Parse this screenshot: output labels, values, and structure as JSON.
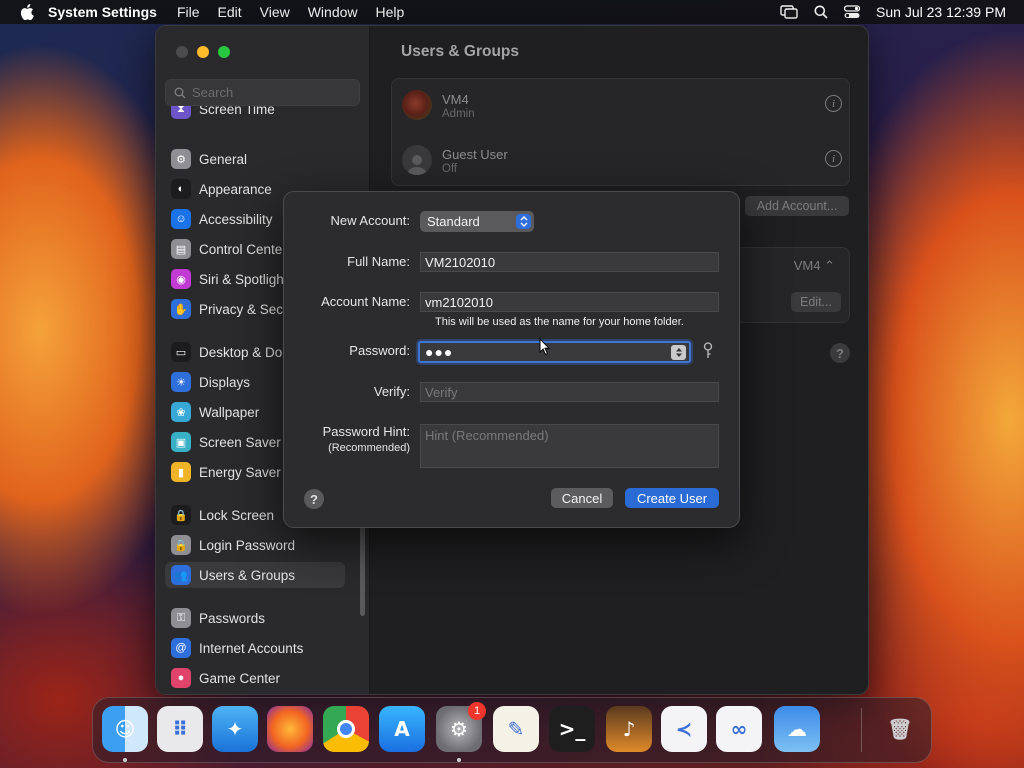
{
  "menubar": {
    "app_name": "System Settings",
    "menus": [
      "File",
      "Edit",
      "View",
      "Window",
      "Help"
    ],
    "clock": "Sun Jul 23  12:39 PM"
  },
  "sidebar": {
    "search_placeholder": "Search",
    "items": [
      {
        "label": "Screen Time",
        "icon": "hourglass-icon",
        "color": "#6b55c8"
      },
      {
        "label": "General",
        "icon": "gear-icon",
        "color": "#8e8e93"
      },
      {
        "label": "Appearance",
        "icon": "appearance-icon",
        "color": "#1c1c1e"
      },
      {
        "label": "Accessibility",
        "icon": "accessibility-icon",
        "color": "#1a73e8"
      },
      {
        "label": "Control Center",
        "icon": "control-center-icon",
        "color": "#8e8e93"
      },
      {
        "label": "Siri & Spotlight",
        "icon": "siri-icon",
        "color": "#c23bd4"
      },
      {
        "label": "Privacy & Security",
        "icon": "hand-icon",
        "color": "#2f6fdb"
      },
      {
        "label": "Desktop & Dock",
        "icon": "dock-icon",
        "color": "#1c1c1e"
      },
      {
        "label": "Displays",
        "icon": "sun-icon",
        "color": "#2f6fdb"
      },
      {
        "label": "Wallpaper",
        "icon": "wallpaper-icon",
        "color": "#38a9d6"
      },
      {
        "label": "Screen Saver",
        "icon": "screen-saver-icon",
        "color": "#38b0c6"
      },
      {
        "label": "Energy Saver",
        "icon": "battery-icon",
        "color": "#f0b429"
      },
      {
        "label": "Lock Screen",
        "icon": "lock-icon",
        "color": "#1c1c1e"
      },
      {
        "label": "Login Password",
        "icon": "lock-icon",
        "color": "#8e8e93"
      },
      {
        "label": "Users & Groups",
        "icon": "users-icon",
        "color": "#2f6fdb"
      },
      {
        "label": "Passwords",
        "icon": "key-icon",
        "color": "#8e8e93"
      },
      {
        "label": "Internet Accounts",
        "icon": "at-icon",
        "color": "#2f6fdb"
      },
      {
        "label": "Game Center",
        "icon": "game-center-icon",
        "color": "#e0446a"
      }
    ]
  },
  "content": {
    "title": "Users & Groups",
    "users": [
      {
        "name": "VM4",
        "role": "Admin"
      },
      {
        "name": "Guest User",
        "role": "Off"
      }
    ],
    "add_account_label": "Add Account...",
    "auto_login_value": "VM4",
    "edit_label": "Edit..."
  },
  "dialog": {
    "new_account_label": "New Account:",
    "new_account_value": "Standard",
    "full_name_label": "Full Name:",
    "full_name_value": "VM2102010",
    "account_name_label": "Account Name:",
    "account_name_value": "vm2102010",
    "home_folder_note": "This will be used as the name for your home folder.",
    "password_label": "Password:",
    "password_dots": "●●●",
    "verify_label": "Verify:",
    "verify_placeholder": "Verify",
    "hint_label": "Password Hint:",
    "hint_sublabel": "(Recommended)",
    "hint_placeholder": "Hint (Recommended)",
    "cancel_label": "Cancel",
    "create_label": "Create User",
    "help_label": "?"
  },
  "dock": {
    "apps": [
      {
        "name": "finder-icon",
        "running": true
      },
      {
        "name": "launchpad-icon",
        "running": false
      },
      {
        "name": "safari-icon",
        "running": false
      },
      {
        "name": "firefox-icon",
        "running": false
      },
      {
        "name": "chrome-icon",
        "running": false
      },
      {
        "name": "app-store-icon",
        "running": false
      },
      {
        "name": "system-settings-icon",
        "running": true,
        "badge": "1"
      },
      {
        "name": "textedit-icon",
        "running": false
      },
      {
        "name": "terminal-icon",
        "running": false
      },
      {
        "name": "garageband-icon",
        "running": false
      },
      {
        "name": "vscode-icon",
        "running": false
      },
      {
        "name": "visual-studio-icon",
        "running": false
      },
      {
        "name": "weather-icon",
        "running": false
      },
      {
        "name": "trash-icon",
        "running": false
      }
    ]
  }
}
